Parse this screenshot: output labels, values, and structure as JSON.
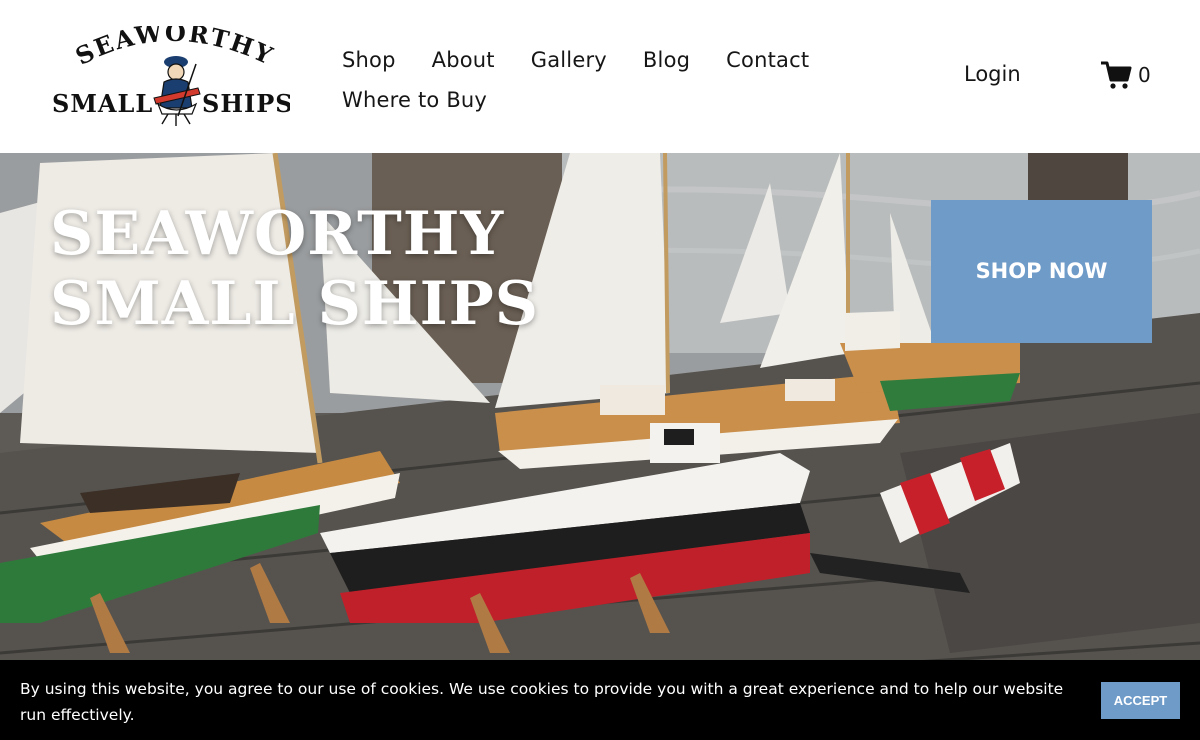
{
  "brand": {
    "logo_top": "SEAWORTHY",
    "logo_left": "SMALL",
    "logo_right": "SHIPS"
  },
  "nav": {
    "items": [
      {
        "label": "Shop"
      },
      {
        "label": "About"
      },
      {
        "label": "Gallery"
      },
      {
        "label": "Blog"
      },
      {
        "label": "Contact"
      },
      {
        "label": "Where to Buy"
      }
    ],
    "login_label": "Login",
    "cart_count": "0"
  },
  "hero": {
    "title": "SEAWORTHY SMALL SHIPS",
    "cta_label": "SHOP NOW"
  },
  "cookie": {
    "text": "By using this website, you agree to our use of cookies. We use cookies to provide you with a great experience and to help our website run effectively.",
    "accept_label": "ACCEPT"
  },
  "colors": {
    "accent": "#6f9bc9",
    "cookie_bg": "#000000",
    "text": "#161616"
  },
  "icons": [
    "logo-emblem-icon",
    "cart-icon"
  ]
}
